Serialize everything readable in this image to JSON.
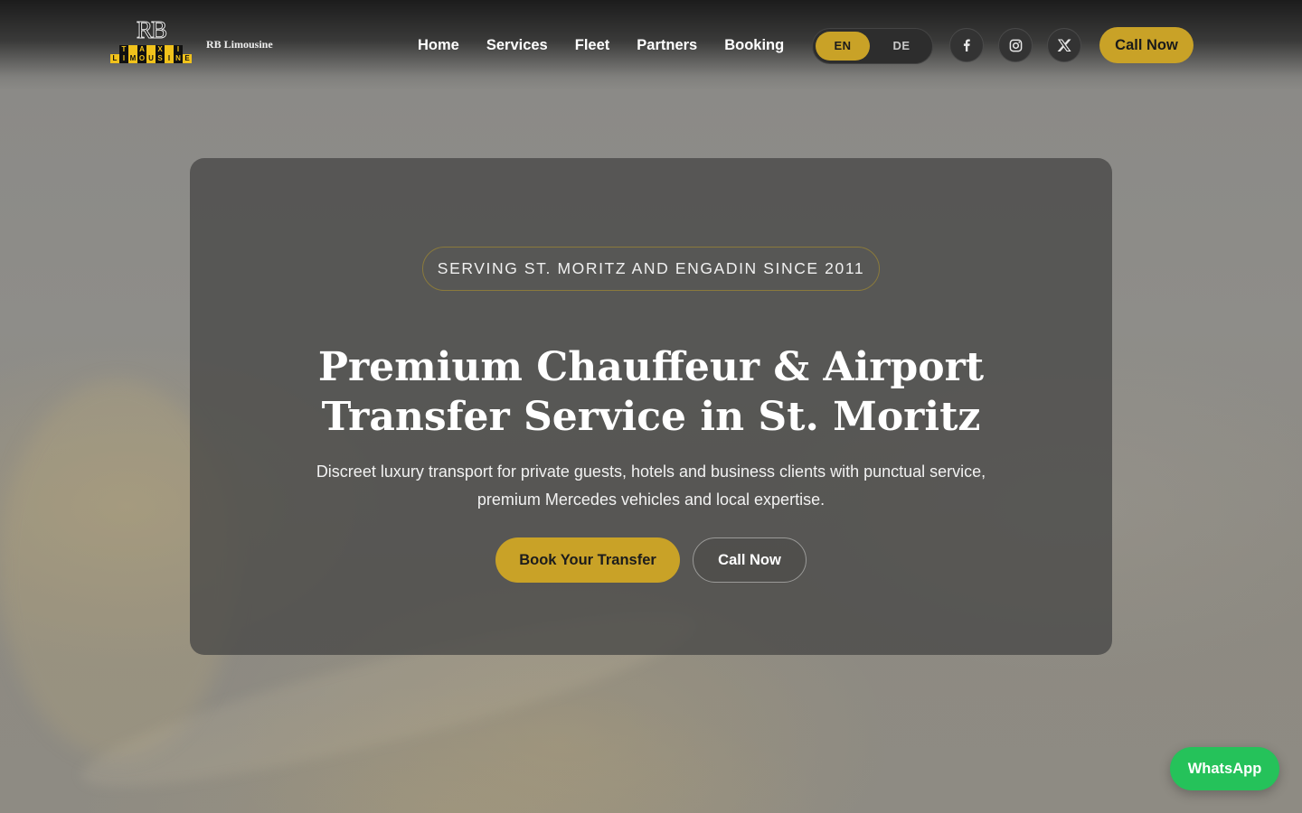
{
  "header": {
    "logo": {
      "monogram": "RB",
      "row1": [
        "T",
        "A",
        "X",
        "I"
      ],
      "row2": [
        "L",
        "I",
        "M",
        "O",
        "U",
        "S",
        "I",
        "N",
        "E"
      ]
    },
    "brand_name": "RB Limousine",
    "nav": [
      "Home",
      "Services",
      "Fleet",
      "Partners",
      "Booking"
    ],
    "language": {
      "options": [
        "EN",
        "DE"
      ],
      "selected": "EN"
    },
    "social_icons": [
      "facebook-icon",
      "instagram-icon",
      "x-twitter-icon"
    ],
    "call_label": "Call Now"
  },
  "hero": {
    "tagline": "SERVING ST. MORITZ AND ENGADIN SINCE 2011",
    "title_line1": "Premium Chauffeur & Airport",
    "title_line2": "Transfer Service in St. Moritz",
    "subtitle_line1": "Discreet luxury transport for private guests, hotels and business clients with punctual service,",
    "subtitle_line2": "premium Mercedes vehicles and local expertise.",
    "primary_button": "Book Your Transfer",
    "secondary_button": "Call Now"
  },
  "floating": {
    "whatsapp_label": "WhatsApp"
  },
  "colors": {
    "accent": "#c9a227",
    "whatsapp": "#25c25a",
    "card": "#484846"
  }
}
